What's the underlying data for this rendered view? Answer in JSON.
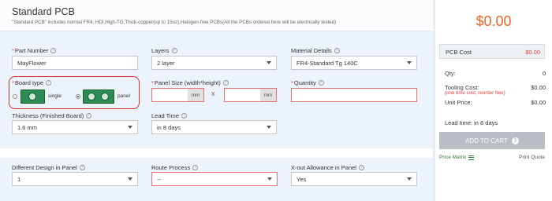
{
  "header": {
    "title": "Standard PCB",
    "subtitle": "\"Standard PCB\" includes normal FR4, HDI,High-TG,Thick-copper(up to 15oz),Halogen-free PCBs(All the PCBs ordered here will be electrically tested)"
  },
  "form": {
    "part_number": {
      "label": "Part Number",
      "value": "MayFlower"
    },
    "layers": {
      "label": "Layers",
      "value": "2 layer"
    },
    "material": {
      "label": "Material Details",
      "value": "FR4-Standard Tg 140C"
    },
    "board_type": {
      "label": "Board type",
      "opt_single": "single",
      "opt_panel": "panel",
      "selected": "panel"
    },
    "panel_size": {
      "label": "Panel Size (width*height)",
      "unit": "mm",
      "times": "X",
      "width": "",
      "height": ""
    },
    "quantity": {
      "label": "Quantity",
      "value": ""
    },
    "thickness": {
      "label": "Thickness (Finished Board)",
      "value": "1.6 mm"
    },
    "lead_time": {
      "label": "Lead Time",
      "value": "in 8 days"
    },
    "diff_design": {
      "label": "Different Design in Panel",
      "value": "1"
    },
    "route": {
      "label": "Route Process",
      "value": "--"
    },
    "xout": {
      "label": "X-out Allowance in Panel",
      "value": "Yes"
    },
    "info_glyph": "?",
    "req_glyph": "*"
  },
  "summary": {
    "total": "$0.00",
    "pcb_cost_label": "PCB Cost",
    "pcb_cost_value": "$0.00",
    "qty_label": "Qty:",
    "qty_value": "0",
    "tooling_label": "Tooling Cost:",
    "tooling_value": "$0.00",
    "tooling_note": "(one time cost, reorder free)",
    "unit_label": "Unit Price:",
    "unit_value": "$0.00",
    "lead_time": "Lead time: in 8 days",
    "add_to_cart": "ADD TO CART",
    "cart_arrow": "❯",
    "price_matrix": "Price Matrix",
    "print_quote": "Print Quote"
  },
  "colors": {
    "accent": "#f26522",
    "required": "#e53935",
    "form_bg": "#ecf3fa",
    "cart_bg": "#b9bec4",
    "pcb_green": "#2e8b57"
  }
}
